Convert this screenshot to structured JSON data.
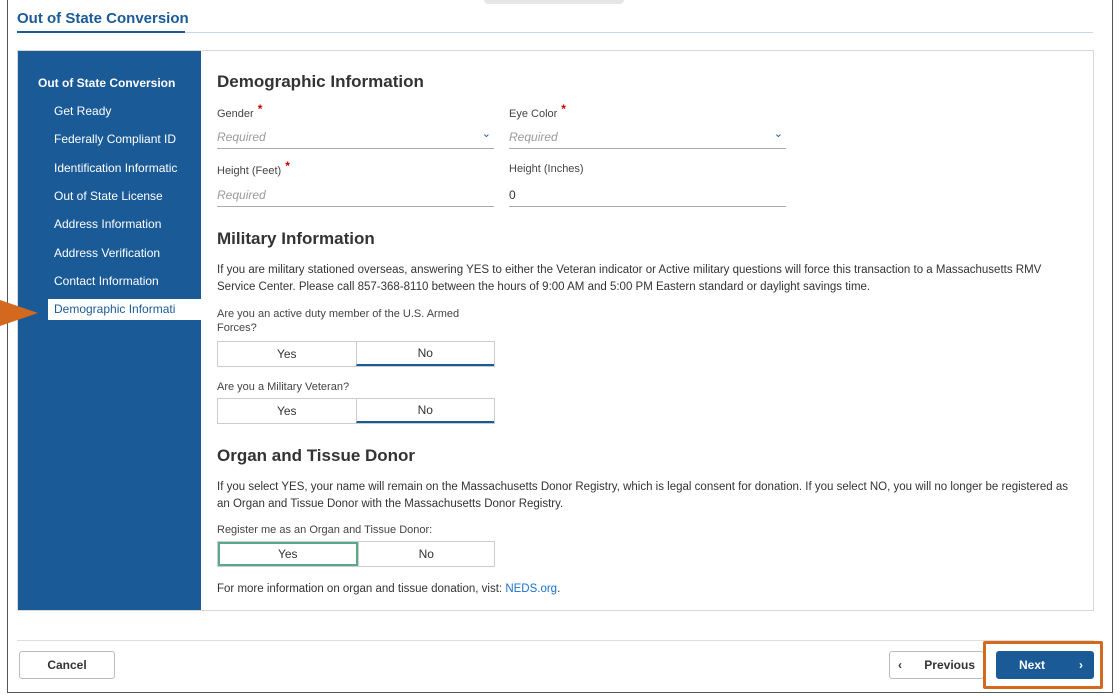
{
  "page": {
    "title": "Out of State Conversion"
  },
  "sidebar": {
    "title": "Out of State Conversion",
    "items": [
      {
        "label": "Get Ready"
      },
      {
        "label": "Federally Compliant ID"
      },
      {
        "label": "Identification Informatic"
      },
      {
        "label": "Out of State License"
      },
      {
        "label": "Address Information"
      },
      {
        "label": "Address Verification"
      },
      {
        "label": "Contact Information"
      },
      {
        "label": "Demographic Informati"
      }
    ]
  },
  "demographic": {
    "heading": "Demographic Information",
    "gender": {
      "label": "Gender",
      "placeholder": "Required"
    },
    "eye_color": {
      "label": "Eye Color",
      "placeholder": "Required"
    },
    "height_feet": {
      "label": "Height (Feet)",
      "placeholder": "Required"
    },
    "height_inches": {
      "label": "Height (Inches)",
      "value": "0"
    }
  },
  "military": {
    "heading": "Military Information",
    "notice": "If you are military stationed overseas, answering YES to either the Veteran indicator or Active military questions will force this transaction to a Massachusetts RMV Service Center. Please call 857-368-8110 between the hours of 9:00 AM and 5:00 PM Eastern standard or daylight savings time.",
    "active_duty": {
      "question": "Are you an active duty member of the U.S. Armed Forces?",
      "yes": "Yes",
      "no": "No",
      "selected": "No"
    },
    "veteran": {
      "question": "Are you a Military Veteran?",
      "yes": "Yes",
      "no": "No",
      "selected": "No"
    }
  },
  "donor": {
    "heading": "Organ and Tissue Donor",
    "notice": "If you select YES, your name will remain on the Massachusetts Donor Registry, which is legal consent for donation. If you select NO, you will no longer be registered as an Organ and Tissue Donor with the Massachusetts Donor Registry.",
    "question": "Register me as an Organ and Tissue Donor:",
    "yes": "Yes",
    "no": "No",
    "focused": "Yes",
    "info_prefix": "For more information on organ and tissue donation, vist:",
    "info_link": "NEDS.org",
    "info_suffix": "."
  },
  "footer": {
    "cancel": "Cancel",
    "previous": "Previous",
    "next": "Next",
    "previous_icon": "‹",
    "next_icon": "›"
  },
  "colors": {
    "primary": "#1a5a96",
    "highlight": "#d2691e",
    "required": "#cc0000",
    "focus": "#5aa88a"
  }
}
